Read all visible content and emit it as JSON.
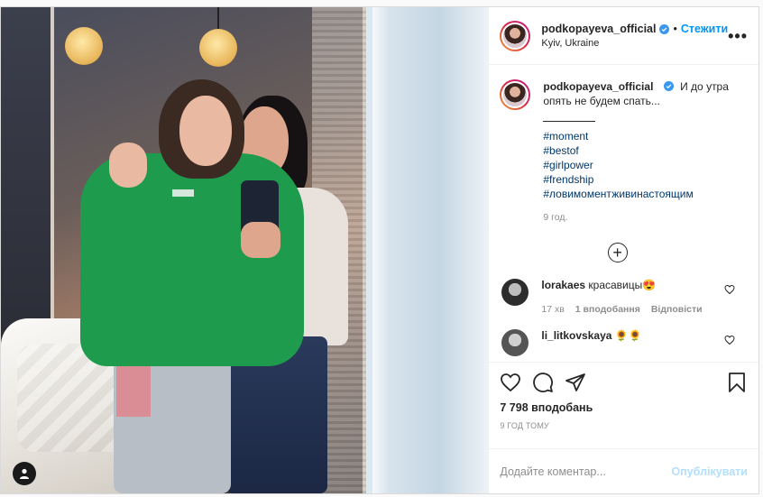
{
  "post": {
    "username": "podkopayeva_official",
    "follow_label": "Стежити",
    "separator": "•",
    "location": "Kyiv, Ukraine",
    "more_label": "•••"
  },
  "caption": {
    "username": "podkopayeva_official",
    "text": "И до утра опять не будем спать...",
    "rule": "",
    "hashtags": [
      "#moment",
      "#bestof",
      "#girlpower",
      "#frendship",
      "#ловимоментживинастоящим"
    ],
    "time": "9 год."
  },
  "load_more_label": "+",
  "comments": [
    {
      "username": "lorakaes",
      "text": "красавицы😍",
      "time": "17 хв",
      "likes": "1 вподобання",
      "reply": "Відповісти"
    },
    {
      "username": "li_litkovskaya",
      "text": "🌻🌻",
      "time": "",
      "likes": "",
      "reply": ""
    }
  ],
  "stats": {
    "likes": "7 798 вподобань",
    "posted": "9 год тому"
  },
  "add_comment": {
    "placeholder": "Додайте коментар...",
    "publish_label": "Опублікувати"
  },
  "colors": {
    "accent": "#0095f6",
    "publish_disabled": "#b2dffc",
    "border": "#dbdbdb"
  },
  "icons": {
    "verified": "verified-badge-icon",
    "heart": "heart-icon",
    "comment": "comment-icon",
    "share": "share-icon",
    "save": "bookmark-icon",
    "tag": "user-tag-icon",
    "more": "more-options-icon"
  }
}
